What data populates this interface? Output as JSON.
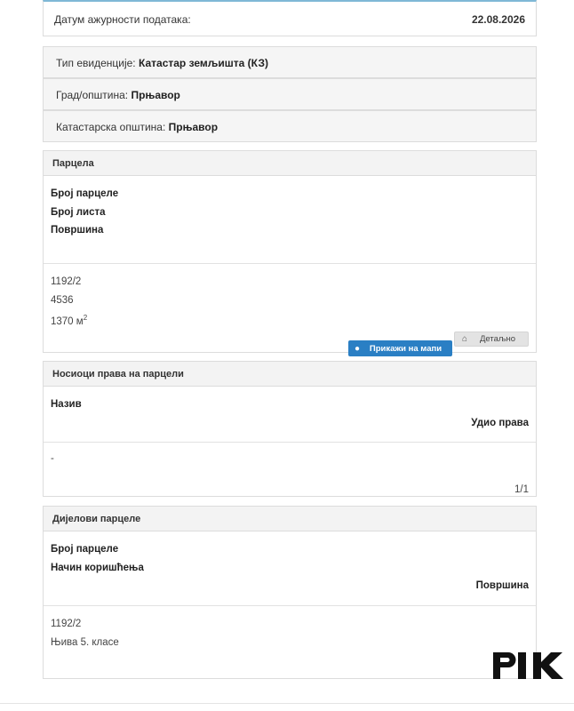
{
  "date_panel": {
    "label": "Датум ажурности података:",
    "value": "22.08.2026"
  },
  "info": {
    "record_type_label": "Тип евиденције:",
    "record_type_value": "Катастар земљишта (КЗ)",
    "city_label": "Град/општина:",
    "city_value": "Прњавор",
    "cadastral_label": "Катастарска општина:",
    "cadastral_value": "Прњавор"
  },
  "parcel": {
    "title": "Парцела",
    "fields": [
      "Број парцеле",
      "Број листа",
      "Површина"
    ],
    "values": [
      "1192/2",
      "4536",
      "1370 м"
    ],
    "area_superscript": "2",
    "map_button": "Прикажи на мапи",
    "detail_button": "Детаљно"
  },
  "owners": {
    "title": "Носиоци права на парцели",
    "col_name": "Назив",
    "col_share": "Удио права",
    "row_name": "-",
    "row_share": "1/1"
  },
  "parts": {
    "title": "Дијелови парцеле",
    "col_number": "Број парцеле",
    "col_usage": "Начин коришћења",
    "col_area": "Површина",
    "row_number": "1192/2",
    "row_usage": "Њива 5. класе"
  },
  "logo": {
    "text": "RIK"
  }
}
